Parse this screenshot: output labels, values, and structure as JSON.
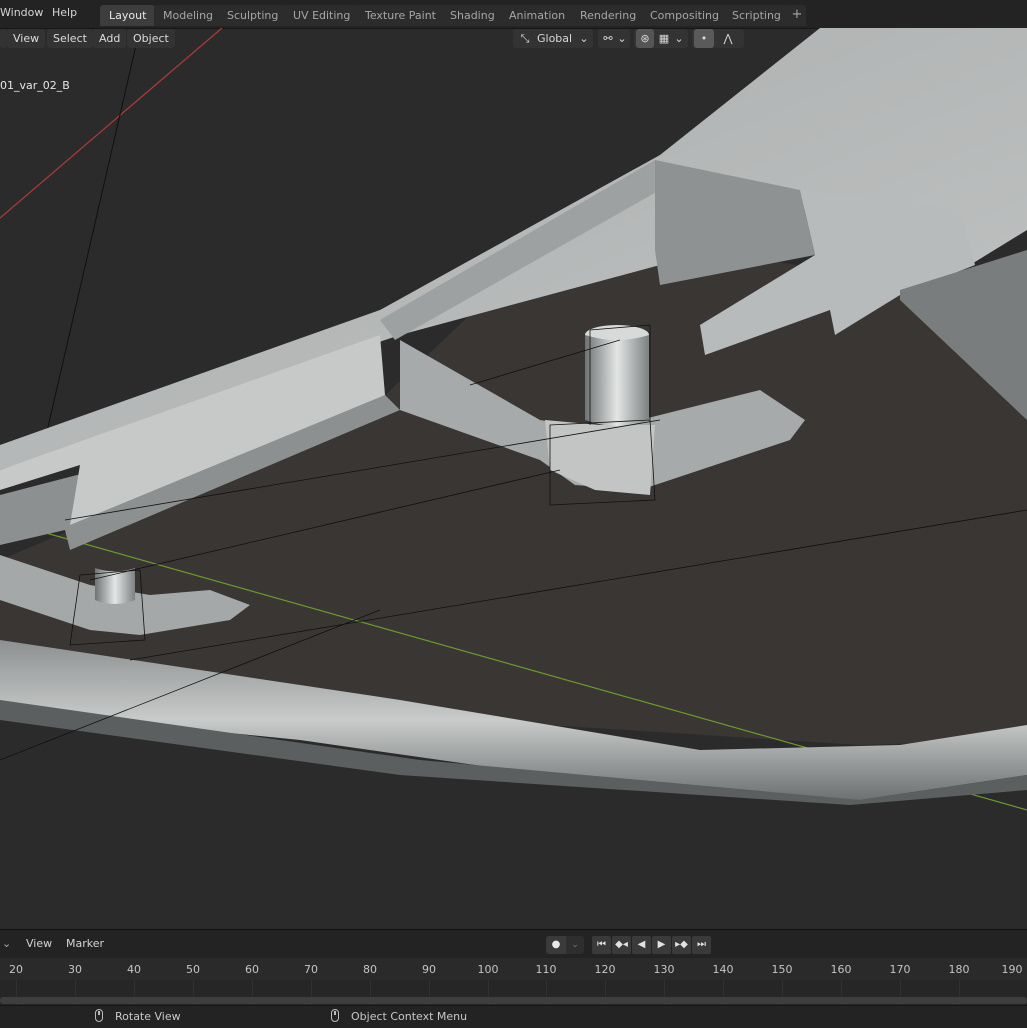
{
  "topbar": {
    "menu": [
      "Window",
      "Help"
    ],
    "workspaces": [
      "Layout",
      "Modeling",
      "Sculpting",
      "UV Editing",
      "Texture Paint",
      "Shading",
      "Animation",
      "Rendering",
      "Compositing",
      "Scripting"
    ],
    "active_workspace": "Layout",
    "add_tab": "+"
  },
  "viewport_header": {
    "menus": [
      "View",
      "Select",
      "Add",
      "Object"
    ],
    "transform_orientation": "Global",
    "pivot_icon": "pivot-icon",
    "snap_icon": "snap-icon",
    "proportional_icon": "proportional-edit-icon",
    "falloff_icon": "falloff-curve-icon"
  },
  "viewport": {
    "object_name": "01_var_02_B",
    "colors": {
      "background": "#2b2b2b",
      "floor": "#3a3634",
      "mesh_light": "#b8bbbb",
      "x_axis": "#b03a3a",
      "y_axis": "#6b9a2a"
    }
  },
  "timeline": {
    "menus": [
      "View",
      "Marker"
    ],
    "record_icon": "record-icon",
    "playback_icons": [
      "jump-start-icon",
      "prev-keyframe-icon",
      "play-reverse-icon",
      "play-icon",
      "next-keyframe-icon",
      "jump-end-icon"
    ],
    "frame_ticks": [
      "20",
      "30",
      "40",
      "50",
      "60",
      "70",
      "80",
      "90",
      "100",
      "110",
      "120",
      "130",
      "140",
      "150",
      "160",
      "170",
      "180",
      "190"
    ]
  },
  "statusbar": {
    "left_hint": "Rotate View",
    "right_hint": "Object Context Menu"
  }
}
